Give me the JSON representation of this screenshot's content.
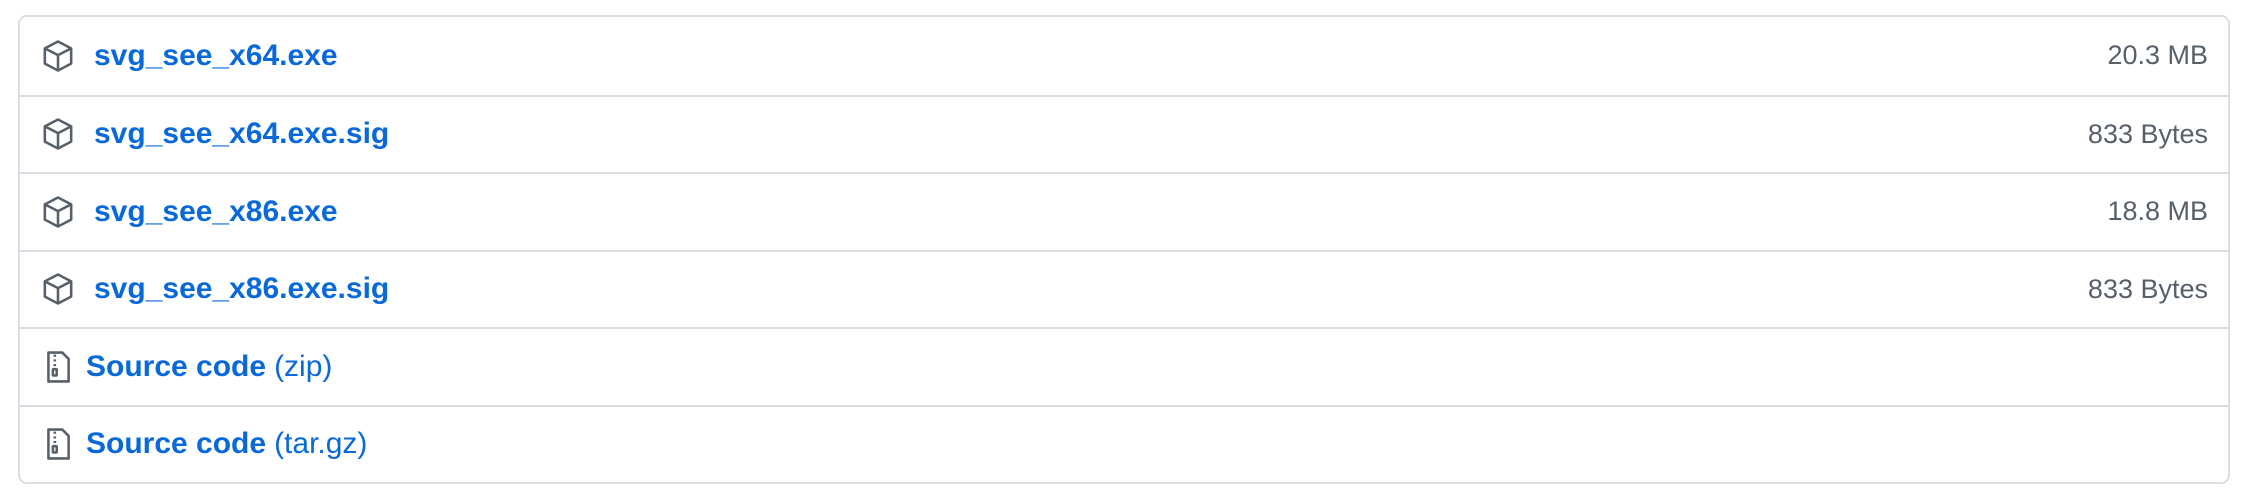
{
  "assets": [
    {
      "name": "svg_see_x64.exe",
      "size": "20.3 MB",
      "icon": "package-icon"
    },
    {
      "name": "svg_see_x64.exe.sig",
      "size": "833 Bytes",
      "icon": "package-icon"
    },
    {
      "name": "svg_see_x86.exe",
      "size": "18.8 MB",
      "icon": "package-icon"
    },
    {
      "name": "svg_see_x86.exe.sig",
      "size": "833 Bytes",
      "icon": "package-icon"
    }
  ],
  "source_code": [
    {
      "label": "Source code",
      "format": "(zip)",
      "icon": "file-zip-icon"
    },
    {
      "label": "Source code",
      "format": "(tar.gz)",
      "icon": "file-zip-icon"
    }
  ],
  "colors": {
    "link": "#0969da",
    "muted": "#57606a",
    "border": "#d8dee4",
    "icon": "#57606a"
  }
}
